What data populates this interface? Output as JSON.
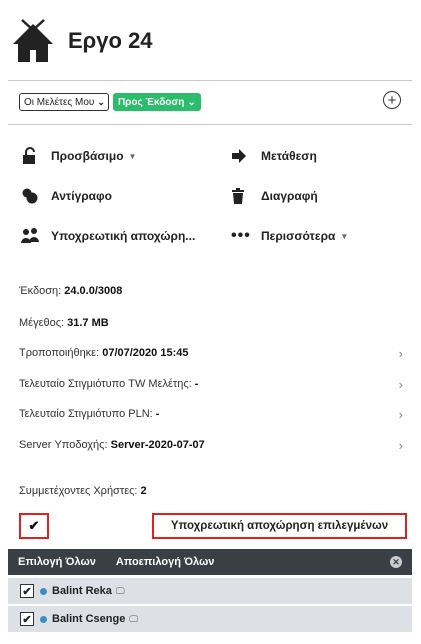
{
  "project": {
    "title": "Εργο 24"
  },
  "filters": {
    "studies_select": "Οι Μελέτες Μου",
    "status_badge": "Προς Έκδοση"
  },
  "actions": {
    "access": "Προσβάσιμο",
    "move": "Μετάθεση",
    "copy": "Αντίγραφο",
    "delete": "Διαγραφή",
    "forced_release": "Υποχρεωτική αποχώρη...",
    "more": "Περισσότερα"
  },
  "info": {
    "version_label": "Έκδοση:",
    "version_value": "24.0.0/3008",
    "size_label": "Μέγεθος:",
    "size_value": "31.7 MB",
    "modified_label": "Τροποποιήθηκε:",
    "modified_value": "07/07/2020 15:45",
    "tw_snapshot_label": "Τελευταίο Στιγμιότυπο TW Μελέτης:",
    "tw_snapshot_value": "-",
    "pln_snapshot_label": "Τελευταίο Στιγμιότυπο PLN:",
    "pln_snapshot_value": "-",
    "server_label": "Server Υποδοχής:",
    "server_value": "Server-2020-07-07",
    "users_label": "Συμμετέχοντες Χρήστες:",
    "users_value": "2"
  },
  "release_selected_label": "Υποχρεωτική αποχώρηση επιλεγμένων",
  "users_bar": {
    "select_all": "Επιλογή Όλων",
    "select_none": "Αποεπιλογή Όλων"
  },
  "users": [
    {
      "name": "Balint Reka",
      "checked": true
    },
    {
      "name": "Balint Csenge",
      "checked": true
    }
  ]
}
